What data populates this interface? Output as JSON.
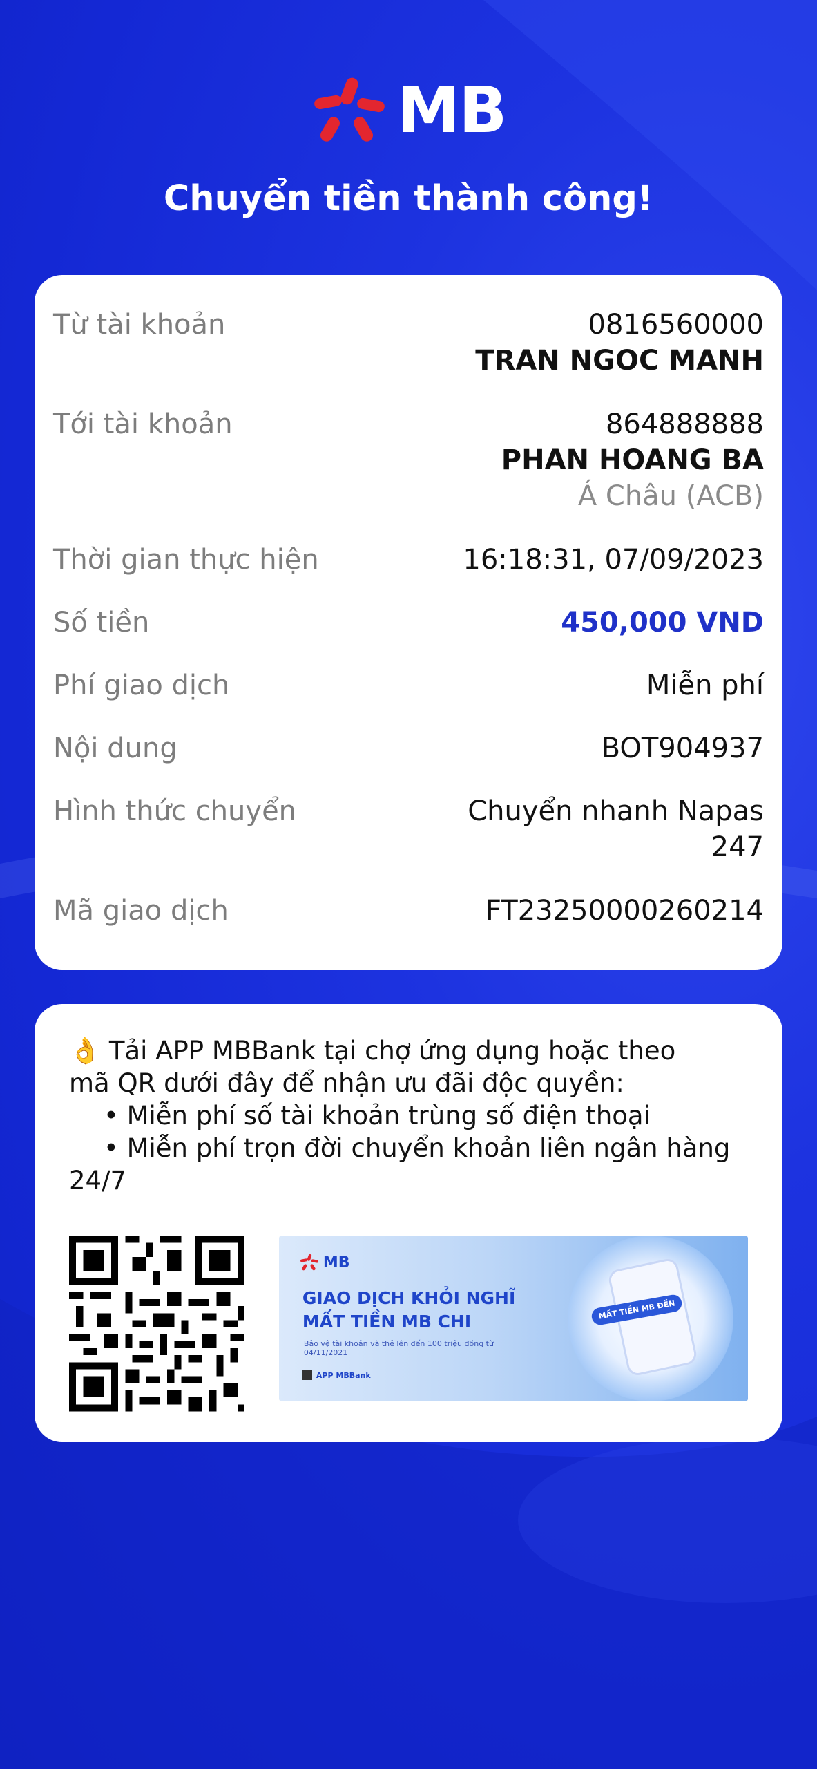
{
  "header": {
    "logo_text": "MB",
    "title": "Chuyển tiền thành công!"
  },
  "transaction": {
    "from_label": "Từ tài khoản",
    "from_account": "0816560000",
    "from_name": "TRAN NGOC MANH",
    "to_label": "Tới tài khoản",
    "to_account": "864888888",
    "to_name": "PHAN HOANG BA",
    "to_bank": "Á Châu (ACB)",
    "time_label": "Thời gian thực hiện",
    "time_value": "16:18:31, 07/09/2023",
    "amount_label": "Số tiền",
    "amount_value": "450,000 VND",
    "fee_label": "Phí giao dịch",
    "fee_value": "Miễn phí",
    "content_label": "Nội dung",
    "content_value": "BOT904937",
    "method_label": "Hình thức chuyển",
    "method_value_1": "Chuyển nhanh Napas",
    "method_value_2": "247",
    "code_label": "Mã giao dịch",
    "code_value": "FT23250000260214"
  },
  "promo": {
    "emoji": "👌",
    "line1": "Tải APP MBBank tại chợ ứng dụng hoặc theo",
    "line2": "mã QR dưới đây để nhận ưu đãi độc quyền:",
    "bullet1": "• Miễn phí số tài khoản trùng số điện thoại",
    "bullet2": "• Miễn phí trọn đời chuyển khoản liên ngân hàng",
    "line_last": "24/7"
  },
  "banner": {
    "logo": "MB",
    "headline1": "GIAO DỊCH KHỎI NGHĨ",
    "headline2": "MẤT TIỀN MB CHI",
    "subtext": "Bảo vệ tài khoản và thẻ lên đến 100 triệu đồng từ 04/11/2021",
    "pill": "MẤT TIỀN MB ĐỀN",
    "app_label": "APP MBBank"
  },
  "colors": {
    "background": "#1428d4",
    "accent_amount": "#1f31c8",
    "logo_red": "#e3262f"
  }
}
